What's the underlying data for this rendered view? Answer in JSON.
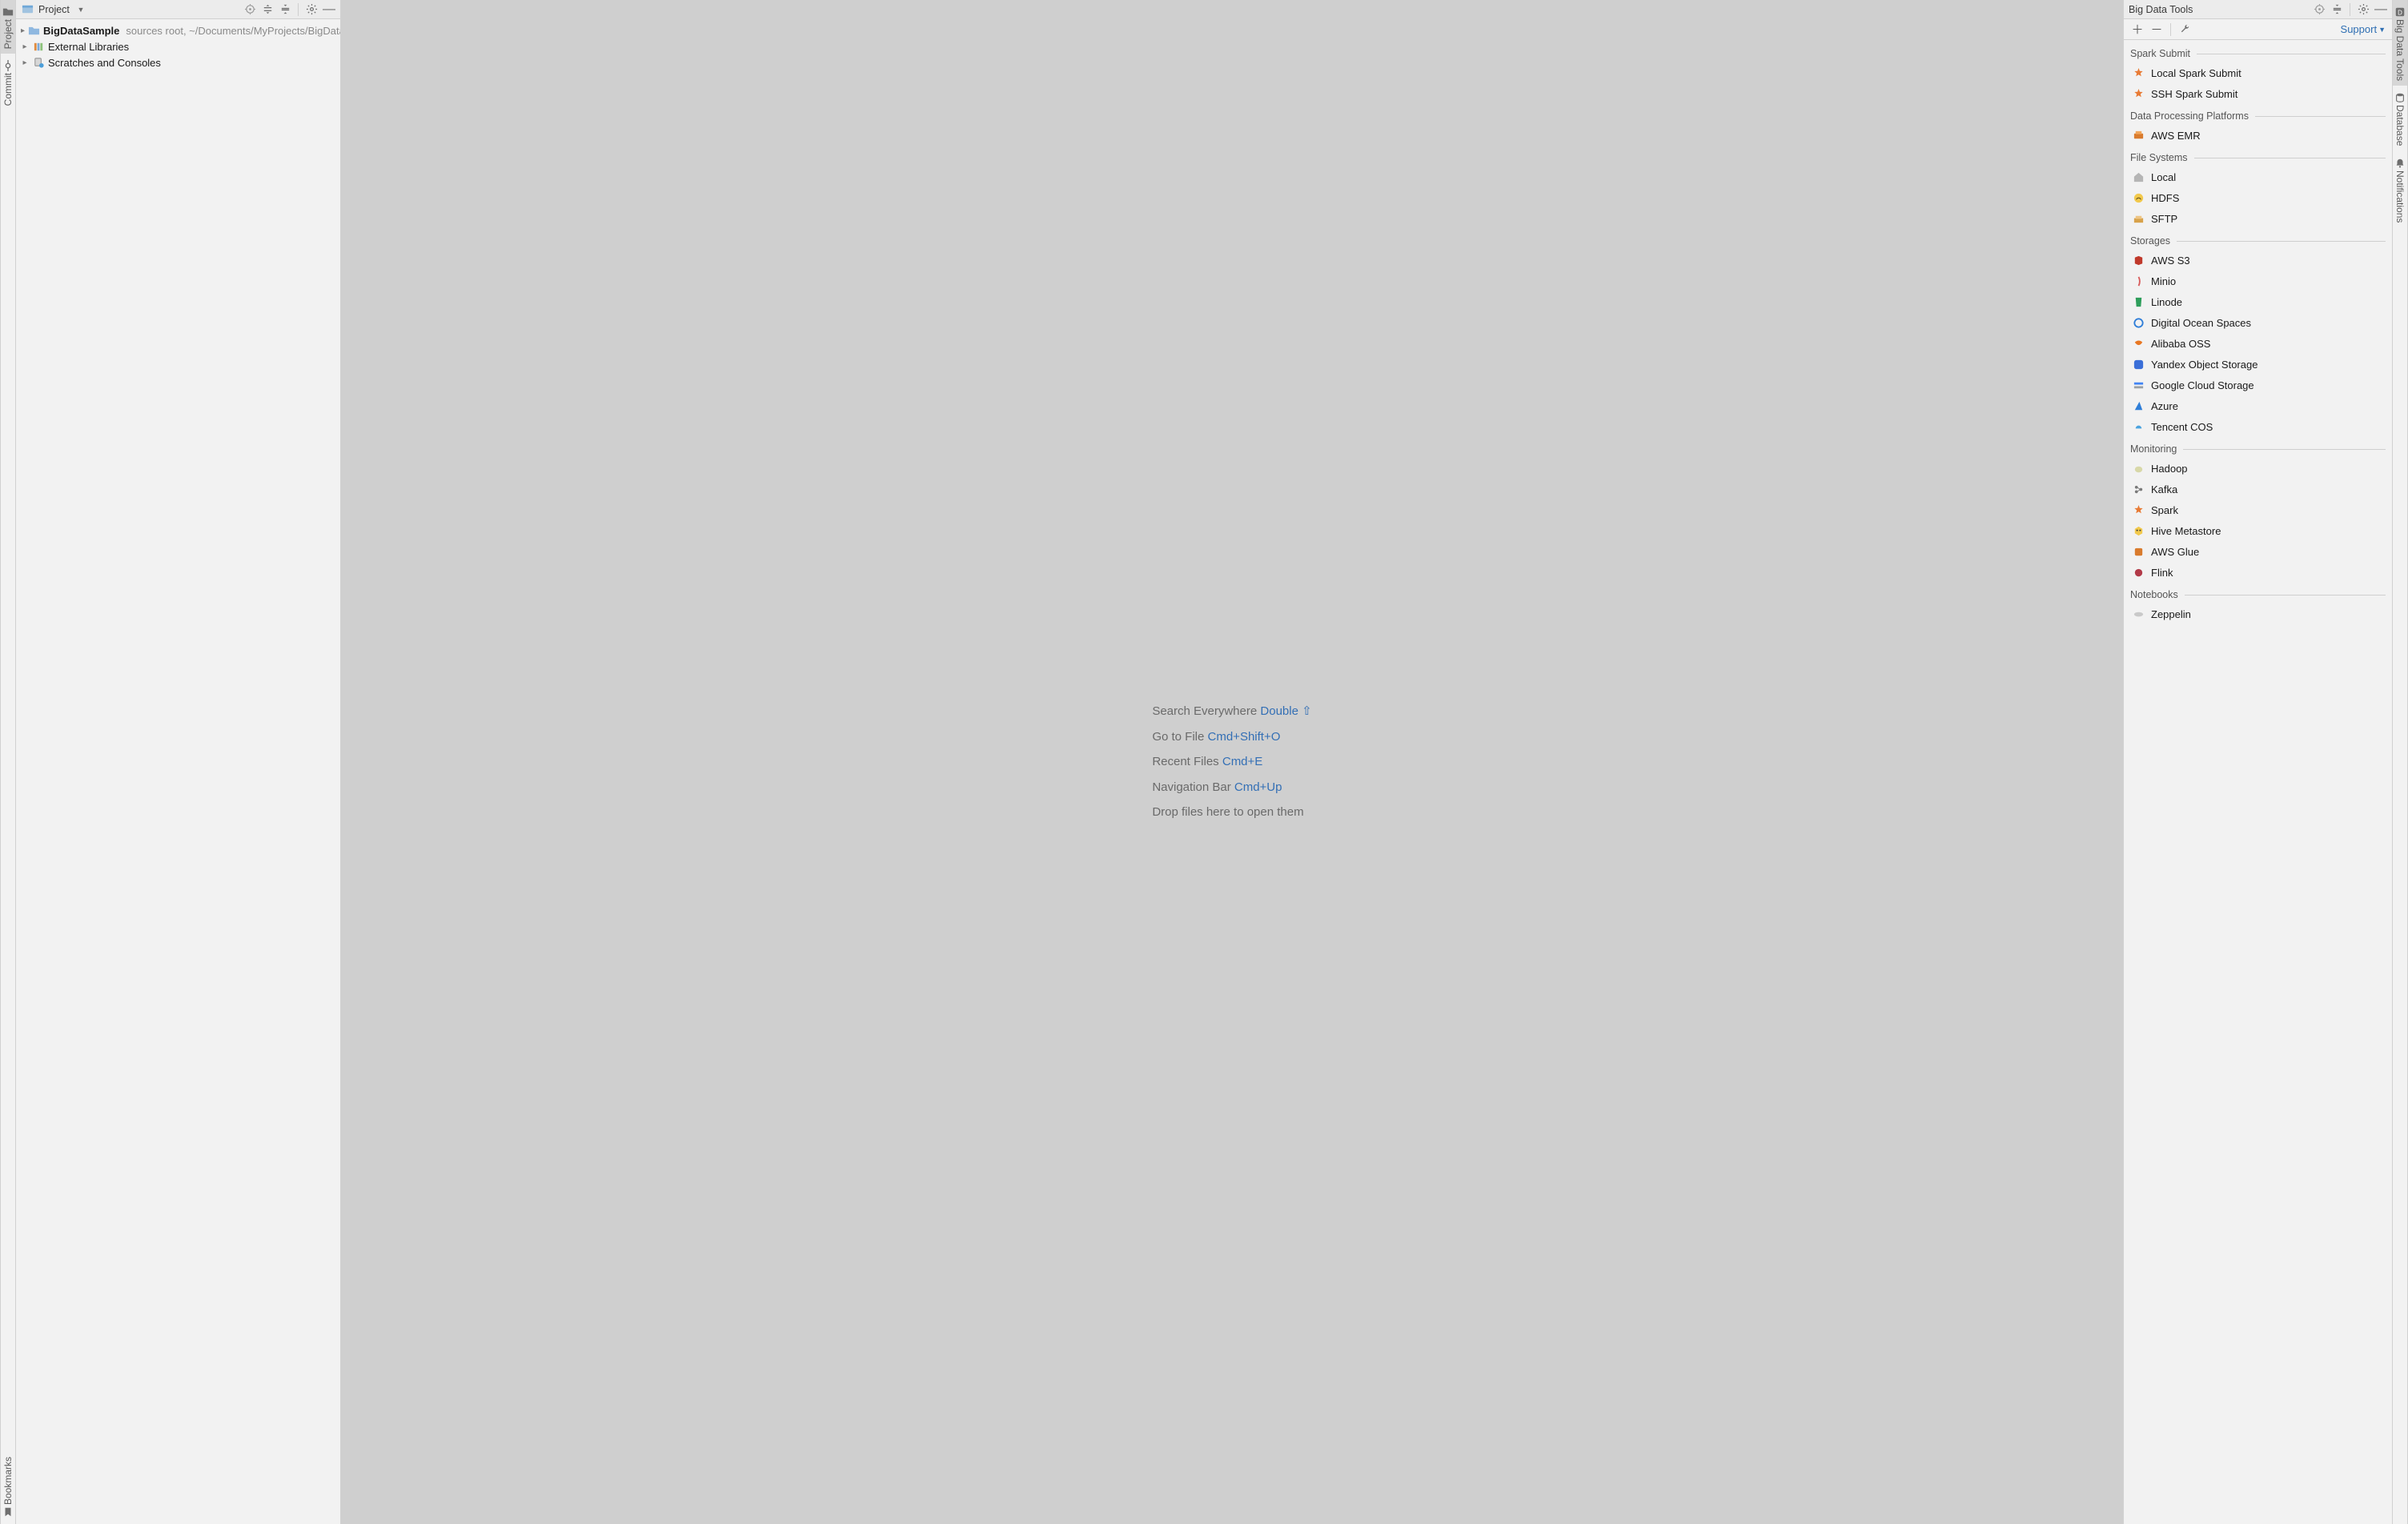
{
  "left_gutter": {
    "project": "Project",
    "commit": "Commit",
    "bookmarks": "Bookmarks"
  },
  "right_gutter": {
    "bdt": "Big Data Tools",
    "database": "Database",
    "notifications": "Notifications"
  },
  "project_panel": {
    "title": "Project",
    "tree": {
      "root_name": "BigDataSample",
      "root_hint": "sources root,  ~/Documents/MyProjects/BigData/E",
      "ext_libs": "External Libraries",
      "scratches": "Scratches and Consoles"
    }
  },
  "editor": {
    "hints": [
      {
        "label": "Search Everywhere",
        "key": "Double ⇧"
      },
      {
        "label": "Go to File",
        "key": "Cmd+Shift+O"
      },
      {
        "label": "Recent Files",
        "key": "Cmd+E"
      },
      {
        "label": "Navigation Bar",
        "key": "Cmd+Up"
      }
    ],
    "drop": "Drop files here to open them"
  },
  "bdt_panel": {
    "title": "Big Data Tools",
    "support": "Support",
    "sections": [
      {
        "title": "Spark Submit",
        "items": [
          {
            "label": "Local Spark Submit",
            "icon": "spark"
          },
          {
            "label": "SSH Spark Submit",
            "icon": "spark"
          }
        ]
      },
      {
        "title": "Data Processing Platforms",
        "items": [
          {
            "label": "AWS EMR",
            "icon": "emr"
          }
        ]
      },
      {
        "title": "File Systems",
        "items": [
          {
            "label": "Local",
            "icon": "home"
          },
          {
            "label": "HDFS",
            "icon": "hdfs"
          },
          {
            "label": "SFTP",
            "icon": "sftp"
          }
        ]
      },
      {
        "title": "Storages",
        "items": [
          {
            "label": "AWS S3",
            "icon": "s3"
          },
          {
            "label": "Minio",
            "icon": "minio"
          },
          {
            "label": "Linode",
            "icon": "linode"
          },
          {
            "label": "Digital Ocean Spaces",
            "icon": "do"
          },
          {
            "label": "Alibaba OSS",
            "icon": "alibaba"
          },
          {
            "label": "Yandex Object Storage",
            "icon": "yandex"
          },
          {
            "label": "Google Cloud Storage",
            "icon": "gcs"
          },
          {
            "label": "Azure",
            "icon": "azure"
          },
          {
            "label": "Tencent COS",
            "icon": "tencent"
          }
        ]
      },
      {
        "title": "Monitoring",
        "items": [
          {
            "label": "Hadoop",
            "icon": "hadoop"
          },
          {
            "label": "Kafka",
            "icon": "kafka"
          },
          {
            "label": "Spark",
            "icon": "spark"
          },
          {
            "label": "Hive Metastore",
            "icon": "hive"
          },
          {
            "label": "AWS Glue",
            "icon": "glue"
          },
          {
            "label": "Flink",
            "icon": "flink"
          }
        ]
      },
      {
        "title": "Notebooks",
        "items": [
          {
            "label": "Zeppelin",
            "icon": "zeppelin"
          }
        ]
      }
    ]
  }
}
